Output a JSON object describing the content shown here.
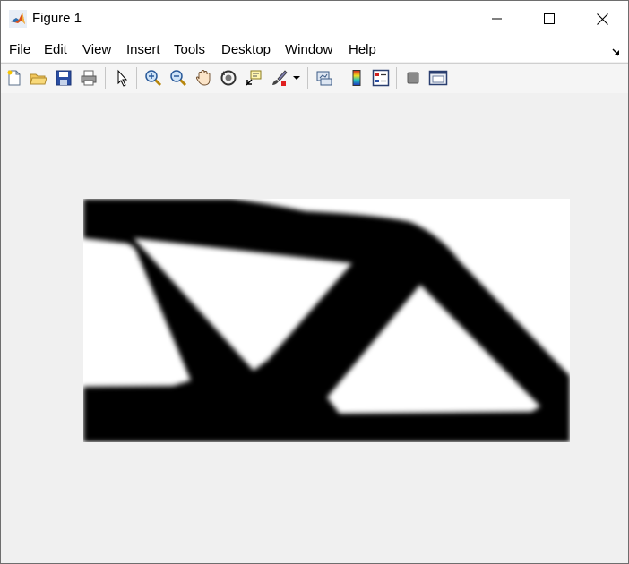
{
  "window": {
    "title": "Figure 1",
    "app_icon": "matlab-icon",
    "controls": [
      "minimize-icon",
      "maximize-icon",
      "close-icon"
    ]
  },
  "menu": {
    "items": [
      "File",
      "Edit",
      "View",
      "Insert",
      "Tools",
      "Desktop",
      "Window",
      "Help"
    ],
    "dock_icon": "dock-arrow-icon"
  },
  "toolbar": {
    "buttons": [
      "new-figure-icon",
      "open-file-icon",
      "save-figure-icon",
      "print-figure-icon",
      "edit-plot-icon",
      "zoom-in-icon",
      "zoom-out-icon",
      "pan-icon",
      "rotate-3d-icon",
      "data-cursor-icon",
      "brush-icon",
      "link-plot-icon",
      "insert-colorbar-icon",
      "insert-legend-icon",
      "hide-plot-tools-icon",
      "show-plot-tools-icon"
    ]
  },
  "figure": {
    "content": "grayscale topology optimization image",
    "colors": {
      "solid": "#000000",
      "void": "#ffffff",
      "background": "#f0f0f0"
    }
  }
}
